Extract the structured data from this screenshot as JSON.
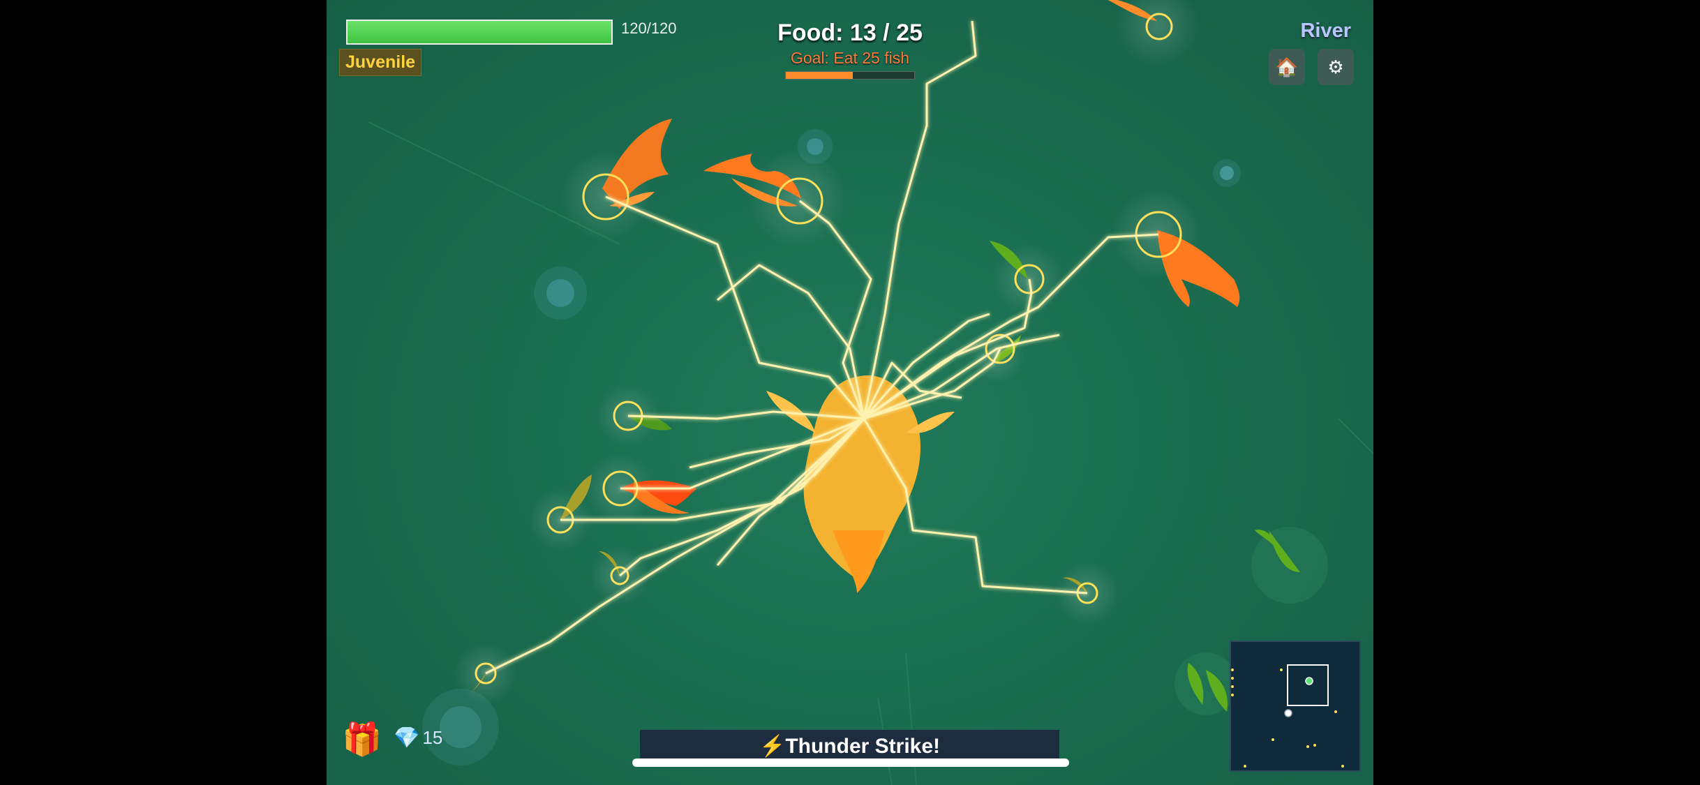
{
  "hud": {
    "health_text": "120/120",
    "health_fraction": 1.0,
    "stage_label": "Juvenile",
    "food_text": "Food: 13 / 25",
    "goal_text": "Goal: Eat 25 fish",
    "goal_progress": 0.52,
    "location": "River",
    "gems_count": "15",
    "ability_banner": "Thunder Strike!",
    "ability_icon": "⚡"
  },
  "icons": {
    "home": "home-icon",
    "settings": "gear-icon",
    "gift": "gift-icon",
    "gem": "gem-icon",
    "lightning": "lightning-icon"
  },
  "colors": {
    "water": "#1a6d50",
    "health": "#4cd04c",
    "goal_bar": "#ff8c2a",
    "lightning": "#fff2b0",
    "player_fish": "#ffb52e",
    "enemy_orange": "#ff7a1f",
    "enemy_green": "#5fae1e",
    "target_ring": "#ffe05a"
  }
}
